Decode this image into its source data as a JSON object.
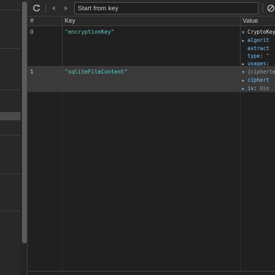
{
  "toolbar": {
    "refresh_icon": "refresh-icon",
    "prev_icon": "chevron-left-icon",
    "next_icon": "chevron-right-icon",
    "search_placeholder": "Start from key",
    "clear_icon": "clear-icon"
  },
  "columns": {
    "index": "#",
    "key": "Key",
    "value": "Value"
  },
  "rows": [
    {
      "index": "0",
      "key": "\"encryptionKey\"",
      "value_head": "CryptoKey",
      "value_lines": [
        {
          "name": "algorit"
        },
        {
          "name": "extract"
        },
        {
          "name": "type",
          "sep": ": ",
          "str": "\""
        },
        {
          "name": "usages",
          "sep": ":"
        }
      ]
    },
    {
      "index": "1",
      "key": "\"sqliteFileContent\"",
      "value_head": "{cipherte",
      "value_lines": [
        {
          "name": "ciphert"
        },
        {
          "name": "iv",
          "sep": ": ",
          "dim": "Uin"
        }
      ]
    }
  ]
}
